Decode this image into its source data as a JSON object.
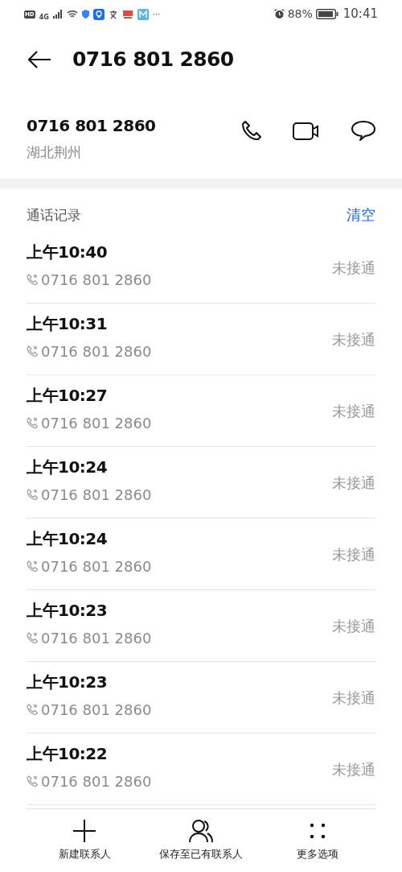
{
  "status_bar": {
    "hd": "HD",
    "network": "4G",
    "more": "···",
    "battery": "88%",
    "time": "10:41"
  },
  "header": {
    "title": "0716 801 2860"
  },
  "contact": {
    "number": "0716 801 2860",
    "location": "湖北荆州"
  },
  "call_log": {
    "title": "通话记录",
    "clear": "清空",
    "rows": [
      {
        "time": "上午10:40",
        "number": "0716 801 2860",
        "status": "未接通"
      },
      {
        "time": "上午10:31",
        "number": "0716 801 2860",
        "status": "未接通"
      },
      {
        "time": "上午10:27",
        "number": "0716 801 2860",
        "status": "未接通"
      },
      {
        "time": "上午10:24",
        "number": "0716 801 2860",
        "status": "未接通"
      },
      {
        "time": "上午10:24",
        "number": "0716 801 2860",
        "status": "未接通"
      },
      {
        "time": "上午10:23",
        "number": "0716 801 2860",
        "status": "未接通"
      },
      {
        "time": "上午10:23",
        "number": "0716 801 2860",
        "status": "未接通"
      },
      {
        "time": "上午10:22",
        "number": "0716 801 2860",
        "status": "未接通"
      }
    ]
  },
  "bottom_bar": [
    {
      "kind": "add",
      "label": "新建联系人"
    },
    {
      "kind": "person",
      "label": "保存至已有联系人"
    },
    {
      "kind": "more",
      "label": "更多选项"
    }
  ]
}
